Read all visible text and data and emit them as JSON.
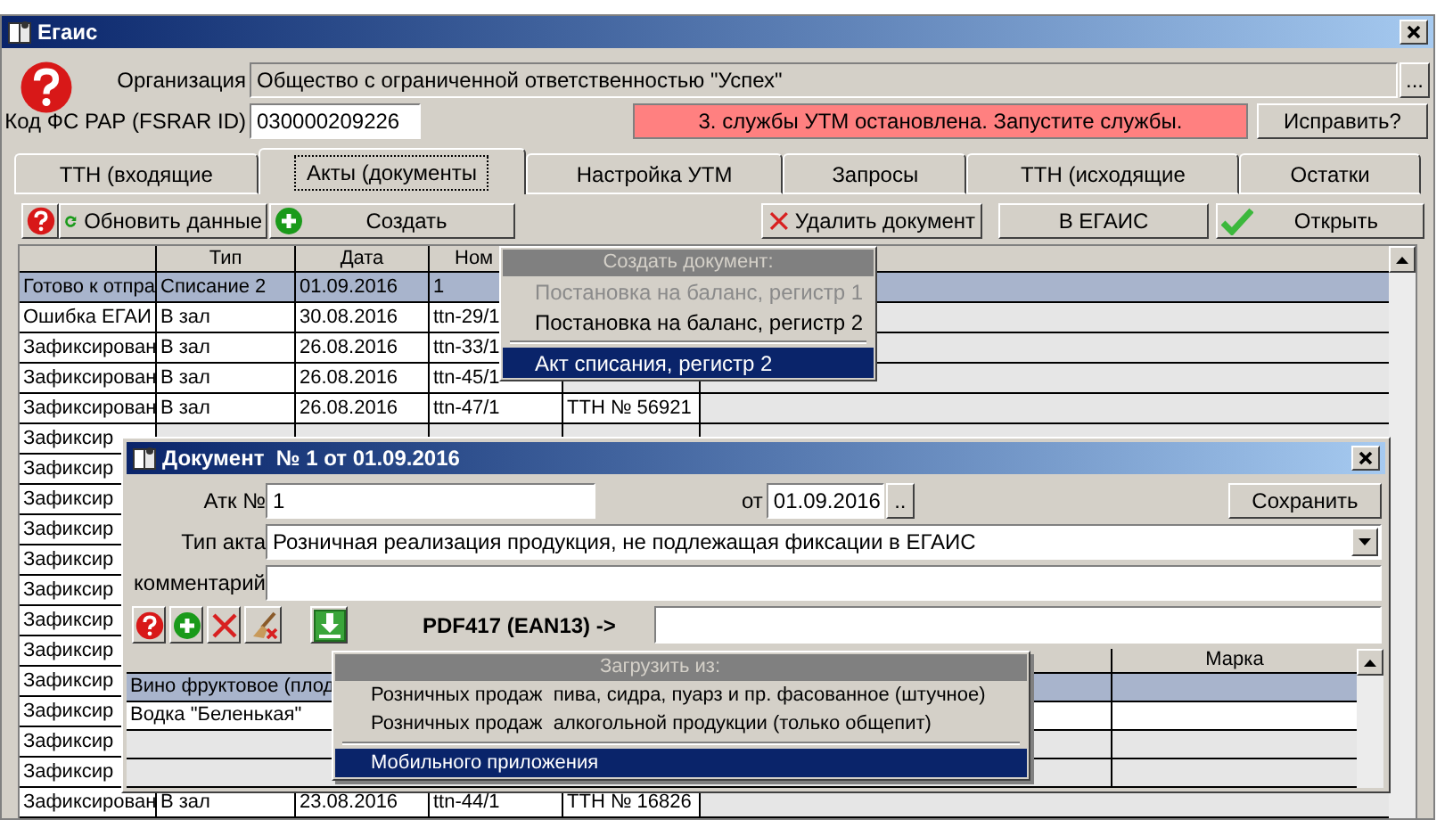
{
  "main_window": {
    "title": "Егаис",
    "organization_label": "Организация",
    "organization": "Общество с ограниченной ответственностью \"Успех\"",
    "browse_button": "...",
    "fsrar_label": "Код ФС РАР (FSRAR ID)",
    "fsrar_id": "030000209226",
    "status_message": "3. службы УТМ остановлена. Запустите службы.",
    "fix_button": "Исправить?"
  },
  "tabs": [
    {
      "label": "ТТН (входящие",
      "selected": false
    },
    {
      "label": "Акты (документы",
      "selected": true
    },
    {
      "label": "Настройка УТМ",
      "selected": false
    },
    {
      "label": "Запросы",
      "selected": false
    },
    {
      "label": "ТТН (исходящие",
      "selected": false
    },
    {
      "label": "Остатки",
      "selected": false
    }
  ],
  "toolbar": {
    "refresh": "Обновить данные",
    "create": "Создать",
    "delete": "Удалить документ",
    "send": "В ЕГАИС",
    "open": "Открыть"
  },
  "table": {
    "columns": [
      "",
      "Тип",
      "Дата",
      "Ном"
    ],
    "rows": [
      {
        "cells": [
          "Готово к отпра",
          "Списание 2",
          "01.09.2016",
          "1"
        ],
        "selected": true
      },
      {
        "cells": [
          "Ошибка ЕГАИ",
          "В зал",
          "30.08.2016",
          "ttn-29/1"
        ],
        "selected": false
      },
      {
        "cells": [
          "Зафиксирован",
          "В зал",
          "26.08.2016",
          "ttn-33/1"
        ],
        "selected": false
      },
      {
        "cells": [
          "Зафиксирован",
          "В зал",
          "26.08.2016",
          "ttn-45/1"
        ],
        "selected": false
      },
      {
        "cells": [
          "Зафиксирован",
          "В зал",
          "26.08.2016",
          "ttn-47/1",
          "ТТН № 56921"
        ],
        "selected": false
      },
      {
        "cells": [
          "Зафиксир"
        ],
        "selected": false
      },
      {
        "cells": [
          "Зафиксир"
        ],
        "selected": false
      },
      {
        "cells": [
          "Зафиксир"
        ],
        "selected": false
      },
      {
        "cells": [
          "Зафиксир"
        ],
        "selected": false
      },
      {
        "cells": [
          "Зафиксир"
        ],
        "selected": false
      },
      {
        "cells": [
          "Зафиксир"
        ],
        "selected": false
      },
      {
        "cells": [
          "Зафиксир"
        ],
        "selected": false
      },
      {
        "cells": [
          "Зафиксир"
        ],
        "selected": false
      },
      {
        "cells": [
          "Зафиксир"
        ],
        "selected": false
      },
      {
        "cells": [
          "Зафиксир"
        ],
        "selected": false
      },
      {
        "cells": [
          "Зафиксир"
        ],
        "selected": false
      },
      {
        "cells": [
          "Зафиксир"
        ],
        "selected": false
      },
      {
        "cells": [
          "Зафиксирован",
          "В зал",
          "23.08.2016",
          "ttn-44/1",
          "ТТН № 16826"
        ],
        "selected": false
      }
    ]
  },
  "create_menu": {
    "title": "Создать документ:",
    "items": [
      {
        "label": "Постановка на баланс, регистр 1",
        "disabled": true,
        "selected": false
      },
      {
        "label": "Постановка на баланс, регистр 2",
        "disabled": false,
        "selected": false
      },
      {
        "label": "Акт списания, регистр 2",
        "disabled": false,
        "selected": true
      }
    ]
  },
  "document_window": {
    "title": "Документ  № 1 от 01.09.2016",
    "act_number_label": "Атк №",
    "act_number": "1",
    "date_label": "от",
    "date": "01.09.2016",
    "date_button": "..",
    "save_button": "Сохранить",
    "act_type_label": "Тип акта",
    "act_type": "Розничная реализация продукция, не подлежащая фиксации в ЕГАИС",
    "comment_label": "комментарий",
    "barcode_label": "PDF417 (EAN13) ->",
    "items": {
      "columns": [
        "Марка"
      ],
      "rows": [
        {
          "name": "Вино фруктовое (плод",
          "selected": true
        },
        {
          "name": "Водка \"Беленькая\"",
          "selected": false
        }
      ]
    }
  },
  "load_menu": {
    "title": "Загрузить из:",
    "items": [
      {
        "label": "Розничных продаж  пива, сидра, пуарз и пр. фасованное (штучное)",
        "selected": false
      },
      {
        "label": "Розничных продаж  алкогольной продукции (только общепит)",
        "selected": false
      },
      {
        "label": "Мобильного приложения",
        "selected": true
      }
    ]
  }
}
